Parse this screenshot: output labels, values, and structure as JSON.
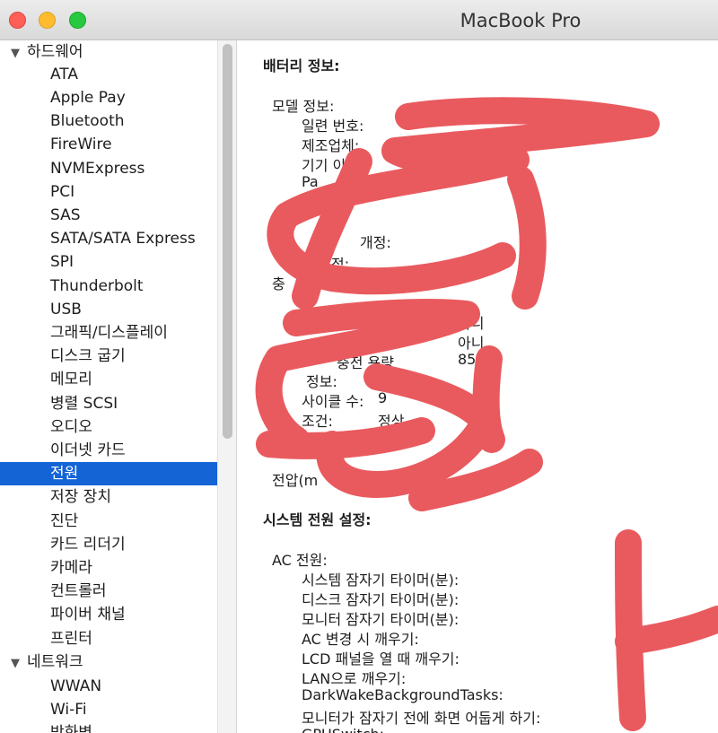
{
  "window": {
    "title": "MacBook Pro"
  },
  "sidebar": {
    "hardware_group": "하드웨어",
    "hardware_items": [
      "ATA",
      "Apple Pay",
      "Bluetooth",
      "FireWire",
      "NVMExpress",
      "PCI",
      "SAS",
      "SATA/SATA Express",
      "SPI",
      "Thunderbolt",
      "USB",
      "그래픽/디스플레이",
      "디스크 굽기",
      "메모리",
      "병렬 SCSI",
      "오디오",
      "이더넷 카드",
      "전원",
      "저장 장치",
      "진단",
      "카드 리더기",
      "카메라",
      "컨트롤러",
      "파이버 채널",
      "프린터"
    ],
    "selected_item": "전원",
    "network_group": "네트워크",
    "network_items": [
      "WWAN",
      "Wi-Fi",
      "방화벽"
    ]
  },
  "detail": {
    "battery_heading": "배터리 정보:",
    "model_info": "모델 정보:",
    "serial": "일련 번호:",
    "manufacturer": "제조업체:",
    "device_name": "기기 이름:",
    "pack_frag": "Pa",
    "revision_frag": "개정:",
    "row_frag": "정:",
    "charge_frag": "충",
    "charge2_frag": "충",
    "val_no1": "아니",
    "val_no2": "아니",
    "full_charge_frag": "충전 용량",
    "full_charge_value": "858",
    "health_info_frag": "정보:",
    "cycle_count_label": "사이클 수:",
    "cycle_count_value": "9",
    "condition_label": "조건:",
    "condition_value": "정상",
    "amperage_frag": "전압(m",
    "system_power_heading": "시스템 전원 설정:",
    "ac_power": "AC 전원:",
    "settings": [
      "시스템 잠자기 타이머(분):",
      "디스크 잠자기 타이머(분):",
      "모니터 잠자기 타이머(분):",
      "AC 변경 시 깨우기:",
      "LCD 패널을 열 때 깨우기:",
      "LAN으로 깨우기:",
      "DarkWakeBackgroundTasks:",
      "모니터가 잠자기 전에 화면 어둡게 하기:",
      "GPUSwitch:"
    ]
  },
  "colors": {
    "selection": "#1464d6",
    "scribble": "#e95a5e"
  }
}
